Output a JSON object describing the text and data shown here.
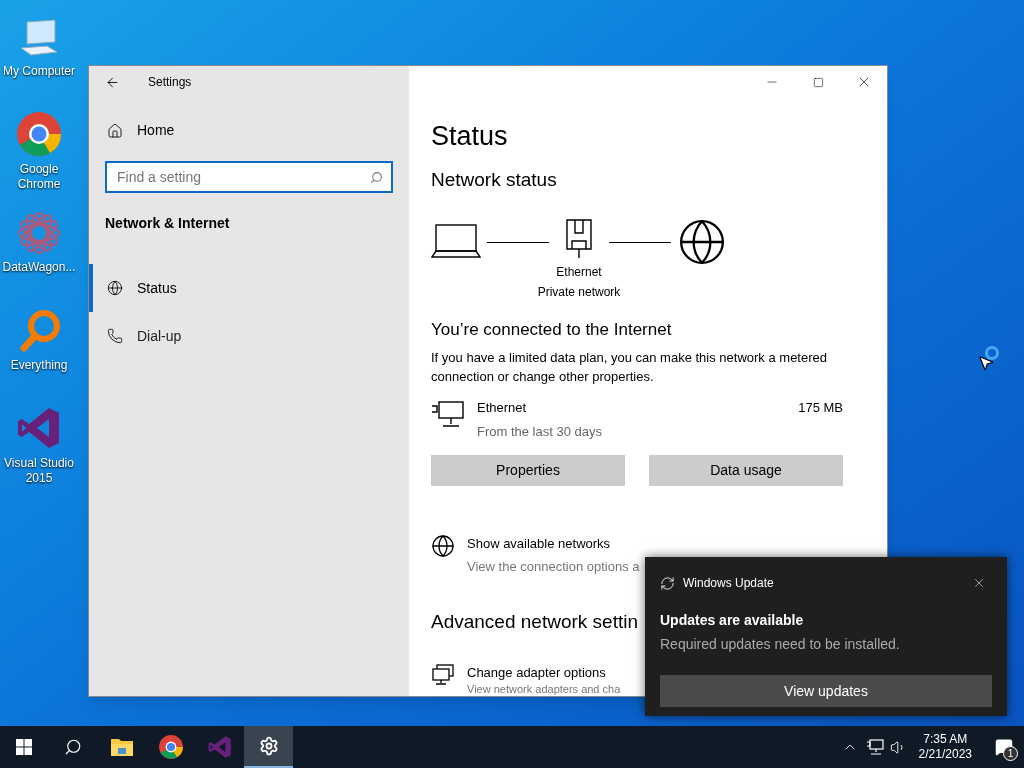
{
  "desktop_icons": [
    {
      "kind": "computer",
      "label": "My Computer"
    },
    {
      "kind": "chrome",
      "label": "Google Chrome"
    },
    {
      "kind": "datawagon",
      "label": "DataWagon..."
    },
    {
      "kind": "everything",
      "label": "Everything"
    },
    {
      "kind": "vs",
      "label": "Visual Studio 2015"
    }
  ],
  "settings": {
    "title": "Settings",
    "home": "Home",
    "search": {
      "placeholder": "Find a setting"
    },
    "section": "Network & Internet",
    "nav": [
      {
        "kind": "status",
        "label": "Status",
        "selected": true
      },
      {
        "kind": "dialup",
        "label": "Dial-up",
        "selected": false
      }
    ],
    "page_title": "Status",
    "network_status": "Network status",
    "diagram_labels": [
      "Ethernet",
      "Private network"
    ],
    "connected_heading": "You’re connected to the Internet",
    "connected_text": "If you have a limited data plan, you can make this network a metered connection or change other properties.",
    "connection": {
      "name": "Ethernet",
      "detail": "From the last 30 days",
      "usage": "175 MB"
    },
    "buttons": [
      "Properties",
      "Data usage"
    ],
    "links": [
      {
        "kind": "globe",
        "title": "Show available networks",
        "description": "View the connection options a"
      }
    ],
    "advanced_heading": "Advanced network settin",
    "advanced_links": [
      {
        "kind": "adapter",
        "title": "Change adapter options",
        "description": "View network adapters and cha"
      }
    ]
  },
  "notification": {
    "app": "Windows Update",
    "title": "Updates are available",
    "body": "Required updates need to be installed.",
    "button": "View updates"
  },
  "taskbar": {
    "apps": [
      {
        "kind": "search",
        "active": false
      },
      {
        "kind": "explorer",
        "active": false
      },
      {
        "kind": "chrome",
        "active": false
      },
      {
        "kind": "vs",
        "active": false
      },
      {
        "kind": "settings",
        "active": true
      }
    ],
    "time": "7:35 AM",
    "date": "2/21/2023",
    "notification_count": "1"
  }
}
